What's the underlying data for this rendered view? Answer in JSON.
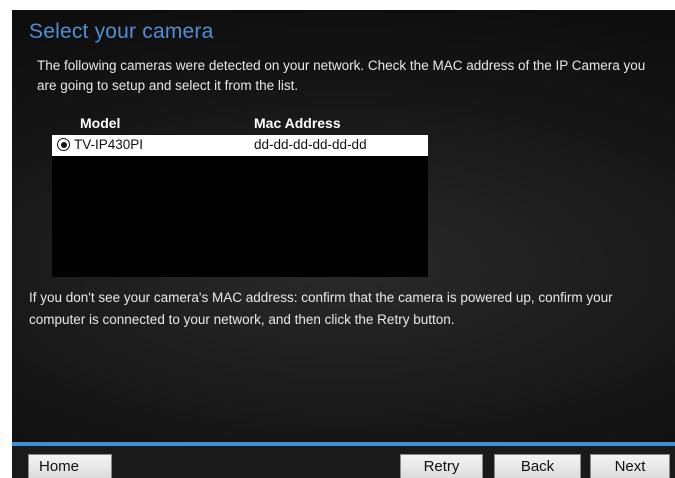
{
  "page": {
    "title": "Select your camera",
    "intro": "The following cameras were detected on your network. Check the MAC address of the IP Camera you are going to setup and select it from the list."
  },
  "camera_list": {
    "headers": {
      "model": "Model",
      "mac": "Mac Address"
    },
    "rows": [
      {
        "model": "TV-IP430PI",
        "mac": "dd-dd-dd-dd-dd-dd",
        "selected": true
      }
    ]
  },
  "help_text": "If you don't see your camera's MAC address: confirm that the camera is powered up, confirm your computer is connected to your network, and then click the Retry button.",
  "footer": {
    "home_label": "Home",
    "retry_label": "Retry",
    "back_label": "Back",
    "next_label": "Next"
  },
  "colors": {
    "accent": "#3f8fd6",
    "title": "#4f8fd4",
    "background": "#151515"
  }
}
